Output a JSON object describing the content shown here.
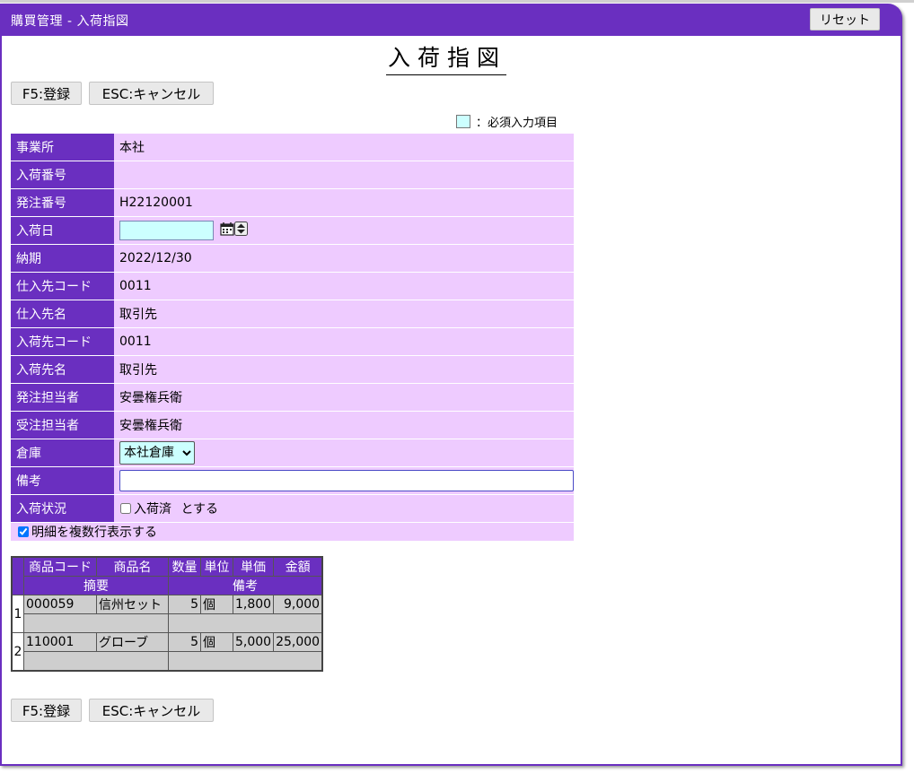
{
  "window": {
    "title": "購買管理 - 入荷指図",
    "reset_label": "リセット"
  },
  "page": {
    "heading": "入荷指図"
  },
  "actions": {
    "save_label": "F5:登録",
    "cancel_label": "ESC:キャンセル"
  },
  "legend": {
    "text": "：必須入力項目",
    "required_color": "#ccffff"
  },
  "form": {
    "office_label": "事業所",
    "office_value": "本社",
    "receipt_no_label": "入荷番号",
    "receipt_no_value": "",
    "order_no_label": "発注番号",
    "order_no_value": "H22120001",
    "receipt_date_label": "入荷日",
    "receipt_date_value": "",
    "due_label": "納期",
    "due_value": "2022/12/30",
    "supplier_code_label": "仕入先コード",
    "supplier_code_value": "0011",
    "supplier_name_label": "仕入先名",
    "supplier_name_value": "取引先",
    "dest_code_label": "入荷先コード",
    "dest_code_value": "0011",
    "dest_name_label": "入荷先名",
    "dest_name_value": "取引先",
    "order_staff_label": "発注担当者",
    "order_staff_value": "安曇権兵衛",
    "recv_staff_label": "受注担当者",
    "recv_staff_value": "安曇権兵衛",
    "warehouse_label": "倉庫",
    "warehouse_value": "本社倉庫",
    "remarks_label": "備考",
    "remarks_value": "",
    "status_label": "入荷状況",
    "status_checkbox_label": "入荷済",
    "status_suffix": "とする",
    "multi_row_label": "明細を複数行表示する"
  },
  "detail": {
    "headers": {
      "code": "商品コード",
      "name": "商品名",
      "qty": "数量",
      "unit": "単位",
      "price": "単価",
      "amount": "金額",
      "summary": "摘要",
      "remarks": "備考"
    },
    "rows": [
      {
        "index": "1",
        "code": "000059",
        "name": "信州セット",
        "qty": "5",
        "unit": "個",
        "price": "1,800",
        "amount": "9,000",
        "summary": "",
        "remarks": ""
      },
      {
        "index": "2",
        "code": "110001",
        "name": "グローブ",
        "qty": "5",
        "unit": "個",
        "price": "5,000",
        "amount": "25,000",
        "summary": "",
        "remarks": ""
      }
    ]
  },
  "colors": {
    "accent": "#6a2fc0",
    "field_bg": "#eecbff",
    "detail_cell": "#cecece"
  }
}
